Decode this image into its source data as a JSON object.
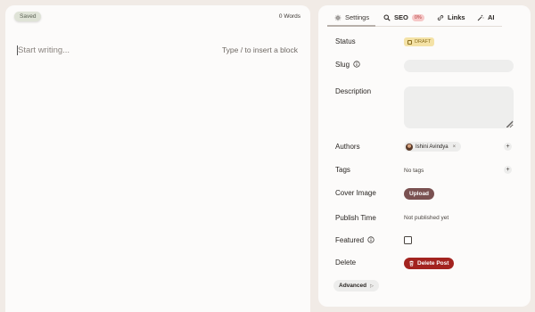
{
  "editor": {
    "save_status": "Saved",
    "word_count": "0 Words",
    "placeholder": "Start writing...",
    "block_hint": "Type / to insert a block"
  },
  "tabs": [
    {
      "label": "Settings",
      "icon": "gear-icon",
      "active": true
    },
    {
      "label": "SEO",
      "icon": "search-icon",
      "badge": "0%"
    },
    {
      "label": "Links",
      "icon": "link-icon"
    },
    {
      "label": "AI",
      "icon": "magic-wand-icon"
    }
  ],
  "fields": {
    "status_label": "Status",
    "status_value": "DRAFT",
    "slug_label": "Slug",
    "slug_value": "",
    "description_label": "Description",
    "description_value": "",
    "authors_label": "Authors",
    "author_name": "Ishini Avindya",
    "tags_label": "Tags",
    "tags_value": "No tags",
    "cover_label": "Cover Image",
    "upload_label": "Upload",
    "publish_label": "Publish Time",
    "publish_value": "Not published yet",
    "featured_label": "Featured",
    "featured_checked": false,
    "delete_label": "Delete",
    "delete_button": "Delete Post",
    "advanced_label": "Advanced"
  },
  "colors": {
    "background": "#f1ebe6",
    "panel": "#fcfbfa",
    "draft_badge": "#f4e2a6",
    "upload_button": "#7a5151",
    "delete_button": "#a3231f",
    "seo_badge": "#f6c8c8"
  }
}
